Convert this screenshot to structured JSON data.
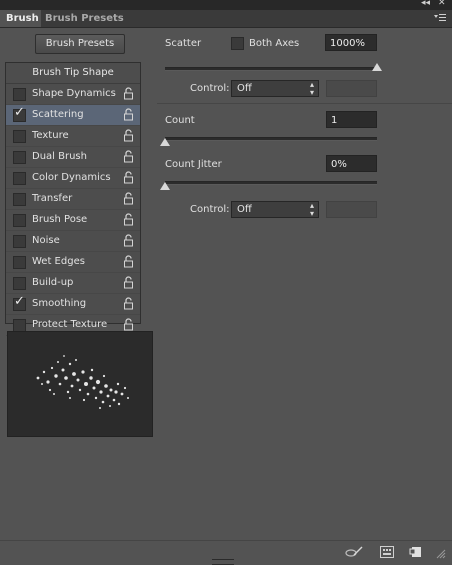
{
  "tabs": [
    {
      "label": "Brush"
    },
    {
      "label": "Brush Presets"
    }
  ],
  "window_controls": {
    "collapse": "◂◂",
    "close": "✕"
  },
  "presets_button": "Brush Presets",
  "tip_shape_header": "Brush Tip Shape",
  "options": [
    {
      "label": "Shape Dynamics",
      "checked": false,
      "selected": false
    },
    {
      "label": "Scattering",
      "checked": true,
      "selected": true
    },
    {
      "label": "Texture",
      "checked": false,
      "selected": false
    },
    {
      "label": "Dual Brush",
      "checked": false,
      "selected": false
    },
    {
      "label": "Color Dynamics",
      "checked": false,
      "selected": false
    },
    {
      "label": "Transfer",
      "checked": false,
      "selected": false
    },
    {
      "label": "Brush Pose",
      "checked": false,
      "selected": false
    },
    {
      "label": "Noise",
      "checked": false,
      "selected": false
    },
    {
      "label": "Wet Edges",
      "checked": false,
      "selected": false
    },
    {
      "label": "Build-up",
      "checked": false,
      "selected": false
    },
    {
      "label": "Smoothing",
      "checked": true,
      "selected": false
    },
    {
      "label": "Protect Texture",
      "checked": false,
      "selected": false
    }
  ],
  "scatter": {
    "label": "Scatter",
    "both_axes_label": "Both Axes",
    "both_axes_checked": false,
    "value": "1000%",
    "slider_fraction": 1.0,
    "control_label": "Control:",
    "control_value": "Off"
  },
  "count": {
    "label": "Count",
    "value": "1",
    "slider_fraction": 0.0
  },
  "count_jitter": {
    "label": "Count Jitter",
    "value": "0%",
    "slider_fraction": 0.0,
    "control_label": "Control:",
    "control_value": "Off"
  },
  "colors": {
    "panel_bg": "#535353",
    "selected_row": "#5b6677",
    "field_bg": "#2c2c2c"
  },
  "bottom_icons": [
    "brush-toggle-icon",
    "grid-icon",
    "new-preset-icon"
  ]
}
